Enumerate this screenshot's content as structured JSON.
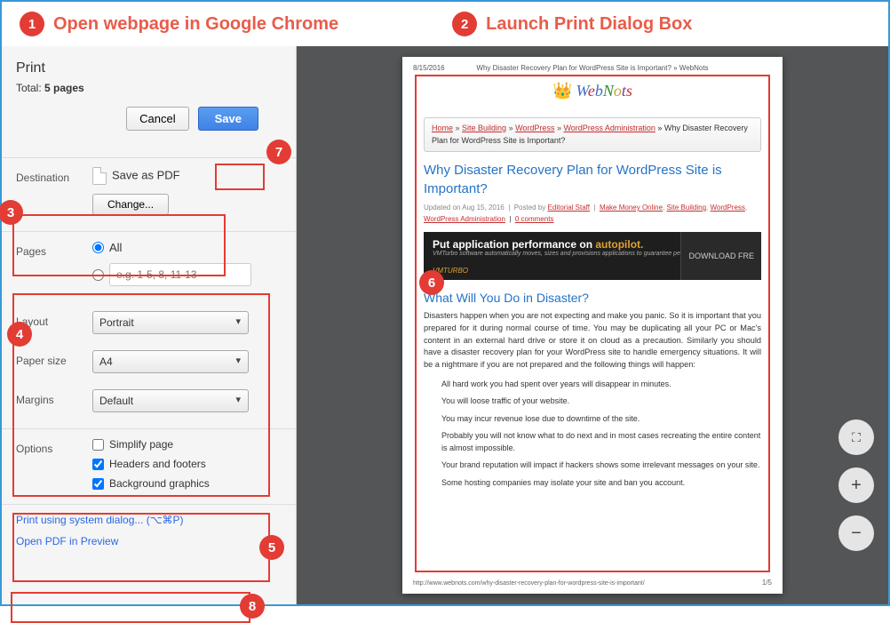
{
  "banner": {
    "step1_num": "1",
    "step1_text": "Open webpage in Google Chrome",
    "step2_num": "2",
    "step2_text": "Launch Print Dialog Box"
  },
  "left": {
    "title": "Print",
    "total_label": "Total: ",
    "total_value": "5 pages",
    "cancel": "Cancel",
    "save": "Save",
    "destination_label": "Destination",
    "destination_value": "Save as PDF",
    "change_btn": "Change...",
    "pages_label": "Pages",
    "pages_all": "All",
    "pages_placeholder": "e.g. 1-5, 8, 11-13",
    "layout_label": "Layout",
    "layout_value": "Portrait",
    "paper_label": "Paper size",
    "paper_value": "A4",
    "margins_label": "Margins",
    "margins_value": "Default",
    "options_label": "Options",
    "opt_simplify": "Simplify page",
    "opt_headers": "Headers and footers",
    "opt_bg": "Background graphics",
    "system_dialog": "Print using system dialog... (⌥⌘P)",
    "open_preview": "Open PDF in Preview"
  },
  "annotations": {
    "a3": "3",
    "a4": "4",
    "a5": "5",
    "a6": "6",
    "a7": "7",
    "a8": "8"
  },
  "preview": {
    "date": "8/15/2016",
    "head_title": "Why Disaster Recovery Plan for WordPress Site is Important? » WebNots",
    "logo_web": "Web",
    "logo_nots": "Nots",
    "bc_home": "Home",
    "bc_site": "Site Building",
    "bc_wp": "WordPress",
    "bc_admin": "WordPress Administration",
    "bc_tail": " » Why Disaster Recovery Plan for WordPress Site is Important?",
    "h1": "Why Disaster Recovery Plan for WordPress Site is Important?",
    "meta_updated": "Updated on Aug 15, 2016",
    "meta_posted": "Posted by ",
    "meta_staff": "Editorial Staff",
    "meta_make": "Make Money Online",
    "meta_sb": "Site Building",
    "meta_wp": "WordPress",
    "meta_wpadmin": "WordPress Administration",
    "meta_comments": "0 comments",
    "ad_title1": "Put application performance on ",
    "ad_title2": "autopilot.",
    "ad_sub": "VMTurbo software automatically moves, sizes and provisions applications to guarantee performance.",
    "ad_vm": "VMTURBO",
    "ad_dl": "DOWNLOAD FRE",
    "h2": "What Will You Do in Disaster?",
    "body": "Disasters happen when you are not expecting and make you panic. So it is important that you prepared for it during normal course of time. You may be duplicating all your PC or Mac's content in an external hard drive or store it on cloud as a precaution. Similarly you should have a disaster recovery plan for your WordPress site to handle emergency situations. It will be a nightmare if you are not prepared and the following things will happen:",
    "list": [
      "All hard work you had spent over years will disappear in minutes.",
      "You will loose traffic of your website.",
      "You may incur revenue lose due to downtime of the site.",
      "Probably you will not know what to do next and in most cases recreating the entire content is almost impossible.",
      "Your brand reputation will impact if hackers shows some irrelevant messages on your site.",
      "Some hosting companies may isolate your site and ban you account."
    ],
    "foot_url": "http://www.webnots.com/why-disaster-recovery-plan-for-wordpress-site-is-important/",
    "foot_page": "1/5"
  },
  "ctrl": {
    "plus": "+",
    "minus": "−",
    "fs": "⛶"
  }
}
